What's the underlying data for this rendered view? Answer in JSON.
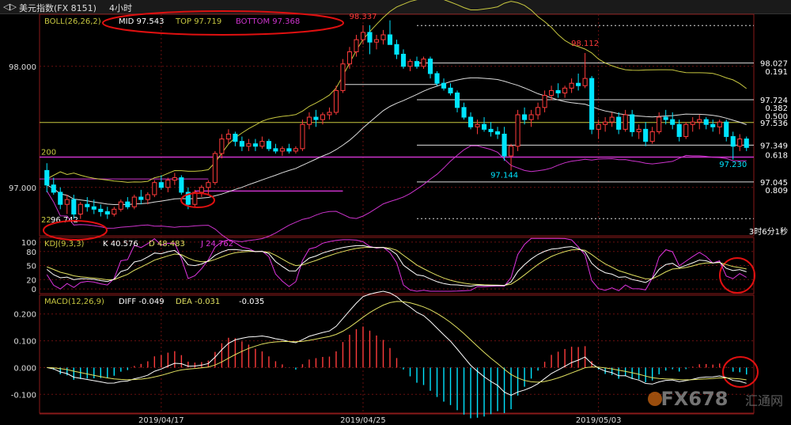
{
  "header": {
    "nav": "◁▷",
    "title": "美元指数(FX 8151)",
    "period": "4小时"
  },
  "boll": {
    "label": "BOLL(26,26,2)",
    "mid": "MID 97.543",
    "top": "TOP 97.719",
    "bottom": "BOTTOM 97.368"
  },
  "kdj": {
    "label": "KDJ(9,3,3)",
    "k": "K 40.576",
    "d": "D 48.483",
    "j": "J 24.762"
  },
  "macd": {
    "label": "MACD(12,26,9)",
    "diff": "DIFF -0.049",
    "dea": "DEA -0.031",
    "macd": "-0.035"
  },
  "price_axis": [
    "98.000",
    "97.000"
  ],
  "kdj_axis": [
    "100",
    "80",
    "50",
    "20",
    "0"
  ],
  "macd_axis": [
    "0.200",
    "0.100",
    "0.000",
    "-0.100"
  ],
  "dates": [
    "2019/04/17",
    "2019/04/25",
    "2019/05/03"
  ],
  "annotations": {
    "hi1": "98.337",
    "hi2": "98.112",
    "lo1": "97.144",
    "lo2": "97.230",
    "low_start": "96.742",
    "mark_200": "200",
    "mark_22": "22",
    "countdown": "3时6分1秒"
  },
  "fib_levels": [
    {
      "label": "98.027"
    },
    {
      "label": "0.191"
    },
    {
      "label": "97.724"
    },
    {
      "label": "0.382"
    },
    {
      "label": "0.500"
    },
    {
      "label": "97.536"
    },
    {
      "label": "97.349"
    },
    {
      "label": "0.618"
    },
    {
      "label": "97.045"
    },
    {
      "label": "0.809"
    }
  ],
  "watermark": "FX678",
  "watermark_sub": "汇通网",
  "colors": {
    "up": "#ff3b3b",
    "down": "#00e5ff",
    "boll_band": "#c8c840",
    "boll_mid": "#dddddd",
    "boll_lower": "#cc33cc",
    "k": "#ffffff",
    "d": "#e0e060",
    "j": "#dd33dd",
    "circle": "#e01010",
    "grid": "#6a1010",
    "axis_text": "#dddddd"
  },
  "chart_data": {
    "type": "candlestick",
    "title": "美元指数(FX 8151) 4小时",
    "ohlc": [
      [
        97.14,
        97.2,
        96.96,
        97.02
      ],
      [
        97.02,
        97.08,
        96.94,
        96.96
      ],
      [
        96.96,
        97.0,
        96.82,
        96.86
      ],
      [
        96.86,
        96.94,
        96.78,
        96.9
      ],
      [
        96.9,
        96.94,
        96.74,
        96.78
      ],
      [
        96.78,
        96.88,
        96.74,
        96.86
      ],
      [
        96.86,
        96.92,
        96.8,
        96.84
      ],
      [
        96.84,
        96.9,
        96.78,
        96.82
      ],
      [
        96.82,
        96.86,
        96.76,
        96.8
      ],
      [
        96.8,
        96.84,
        96.74,
        96.78
      ],
      [
        96.78,
        96.84,
        96.76,
        96.82
      ],
      [
        96.82,
        96.9,
        96.8,
        96.88
      ],
      [
        96.88,
        96.92,
        96.82,
        96.84
      ],
      [
        96.84,
        96.94,
        96.82,
        96.92
      ],
      [
        96.92,
        96.98,
        96.86,
        96.9
      ],
      [
        96.9,
        96.96,
        96.86,
        96.94
      ],
      [
        96.94,
        97.06,
        96.92,
        97.04
      ],
      [
        97.04,
        97.1,
        96.98,
        97.0
      ],
      [
        97.0,
        97.08,
        96.96,
        97.06
      ],
      [
        97.06,
        97.12,
        97.02,
        97.08
      ],
      [
        97.08,
        97.1,
        96.94,
        96.96
      ],
      [
        96.96,
        97.0,
        96.82,
        96.86
      ],
      [
        96.86,
        96.98,
        96.84,
        96.96
      ],
      [
        96.96,
        97.02,
        96.92,
        97.0
      ],
      [
        97.0,
        97.06,
        96.94,
        97.04
      ],
      [
        97.04,
        97.3,
        97.02,
        97.28
      ],
      [
        97.28,
        97.44,
        97.24,
        97.4
      ],
      [
        97.4,
        97.48,
        97.36,
        97.44
      ],
      [
        97.44,
        97.46,
        97.34,
        97.38
      ],
      [
        97.38,
        97.42,
        97.3,
        97.34
      ],
      [
        97.34,
        97.4,
        97.3,
        97.36
      ],
      [
        97.36,
        97.4,
        97.3,
        97.34
      ],
      [
        97.34,
        97.42,
        97.32,
        97.38
      ],
      [
        97.38,
        97.4,
        97.3,
        97.32
      ],
      [
        97.32,
        97.36,
        97.28,
        97.3
      ],
      [
        97.3,
        97.34,
        97.26,
        97.32
      ],
      [
        97.32,
        97.36,
        97.28,
        97.3
      ],
      [
        97.3,
        97.34,
        97.28,
        97.32
      ],
      [
        97.32,
        97.56,
        97.3,
        97.52
      ],
      [
        97.52,
        97.62,
        97.48,
        97.58
      ],
      [
        97.58,
        97.64,
        97.5,
        97.56
      ],
      [
        97.56,
        97.62,
        97.52,
        97.6
      ],
      [
        97.6,
        97.66,
        97.56,
        97.62
      ],
      [
        97.62,
        97.84,
        97.6,
        97.8
      ],
      [
        97.8,
        98.06,
        97.78,
        98.02
      ],
      [
        98.02,
        98.16,
        97.98,
        98.12
      ],
      [
        98.12,
        98.26,
        98.08,
        98.22
      ],
      [
        98.22,
        98.34,
        98.18,
        98.28
      ],
      [
        98.28,
        98.34,
        98.1,
        98.2
      ],
      [
        98.2,
        98.26,
        98.14,
        98.22
      ],
      [
        98.22,
        98.3,
        98.18,
        98.26
      ],
      [
        98.26,
        98.38,
        98.2,
        98.18
      ],
      [
        98.18,
        98.22,
        98.06,
        98.1
      ],
      [
        98.1,
        98.14,
        97.98,
        98.0
      ],
      [
        98.0,
        98.06,
        97.96,
        98.04
      ],
      [
        98.04,
        98.08,
        97.98,
        98.0
      ],
      [
        98.0,
        98.08,
        97.98,
        98.06
      ],
      [
        98.06,
        98.08,
        97.9,
        97.94
      ],
      [
        97.94,
        97.96,
        97.84,
        97.86
      ],
      [
        97.86,
        97.9,
        97.8,
        97.82
      ],
      [
        97.82,
        97.86,
        97.76,
        97.78
      ],
      [
        97.78,
        97.8,
        97.62,
        97.66
      ],
      [
        97.66,
        97.7,
        97.56,
        97.58
      ],
      [
        97.58,
        97.62,
        97.48,
        97.5
      ],
      [
        97.5,
        97.56,
        97.44,
        97.52
      ],
      [
        97.52,
        97.58,
        97.46,
        97.48
      ],
      [
        97.48,
        97.54,
        97.42,
        97.46
      ],
      [
        97.46,
        97.5,
        97.4,
        97.44
      ],
      [
        97.44,
        97.5,
        97.22,
        97.26
      ],
      [
        97.26,
        97.36,
        97.14,
        97.34
      ],
      [
        97.34,
        97.64,
        97.3,
        97.6
      ],
      [
        97.6,
        97.66,
        97.52,
        97.56
      ],
      [
        97.56,
        97.64,
        97.5,
        97.6
      ],
      [
        97.6,
        97.7,
        97.56,
        97.66
      ],
      [
        97.66,
        97.8,
        97.62,
        97.76
      ],
      [
        97.76,
        97.84,
        97.72,
        97.8
      ],
      [
        97.8,
        97.86,
        97.74,
        97.78
      ],
      [
        97.78,
        97.84,
        97.74,
        97.82
      ],
      [
        97.82,
        97.9,
        97.78,
        97.86
      ],
      [
        97.86,
        97.94,
        97.8,
        97.84
      ],
      [
        97.84,
        98.11,
        97.82,
        97.9
      ],
      [
        97.9,
        97.92,
        97.44,
        97.48
      ],
      [
        97.48,
        97.56,
        97.4,
        97.52
      ],
      [
        97.52,
        97.58,
        97.46,
        97.54
      ],
      [
        97.54,
        97.62,
        97.5,
        97.58
      ],
      [
        97.58,
        97.62,
        97.44,
        97.48
      ],
      [
        97.48,
        97.64,
        97.46,
        97.6
      ],
      [
        97.6,
        97.64,
        97.42,
        97.46
      ],
      [
        97.46,
        97.52,
        97.4,
        97.48
      ],
      [
        97.48,
        97.54,
        97.34,
        97.38
      ],
      [
        97.38,
        97.5,
        97.36,
        97.46
      ],
      [
        97.46,
        97.62,
        97.44,
        97.58
      ],
      [
        97.58,
        97.64,
        97.52,
        97.56
      ],
      [
        97.56,
        97.62,
        97.48,
        97.52
      ],
      [
        97.52,
        97.56,
        97.38,
        97.42
      ],
      [
        97.42,
        97.54,
        97.4,
        97.52
      ],
      [
        97.52,
        97.58,
        97.46,
        97.54
      ],
      [
        97.54,
        97.6,
        97.48,
        97.56
      ],
      [
        97.56,
        97.58,
        97.48,
        97.52
      ],
      [
        97.52,
        97.56,
        97.46,
        97.5
      ],
      [
        97.5,
        97.56,
        97.44,
        97.54
      ],
      [
        97.54,
        97.56,
        97.38,
        97.42
      ],
      [
        97.42,
        97.46,
        97.23,
        97.34
      ],
      [
        97.34,
        97.44,
        97.3,
        97.4
      ],
      [
        97.4,
        97.42,
        97.3,
        97.33
      ]
    ],
    "y_range": [
      96.6,
      98.43
    ],
    "kdj_range": [
      -10,
      110
    ],
    "macd_range": [
      -0.17,
      0.27
    ]
  }
}
